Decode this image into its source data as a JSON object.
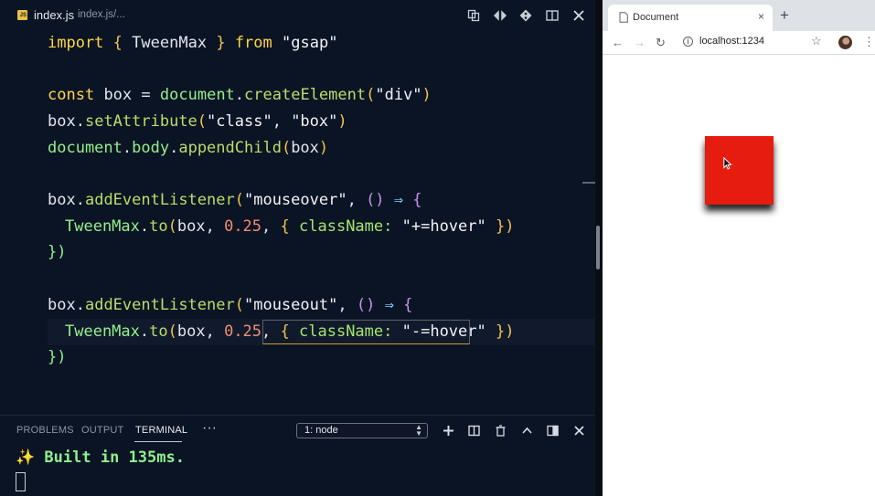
{
  "editor": {
    "tab": {
      "badge": "JS",
      "filename": "index.js",
      "path": "index.js/..."
    },
    "toolbar_icons": [
      "compare-icon",
      "go-live-icon",
      "source-control-icon",
      "split-editor-icon",
      "close-icon"
    ]
  },
  "code": {
    "import_kw": "import",
    "import_open": "{",
    "import_name": "TweenMax",
    "import_close": "}",
    "from_kw": "from",
    "import_src": "\"gsap\"",
    "const_kw": "const",
    "box_var": "box",
    "eq": "=",
    "document": "document",
    "create_element": "createElement",
    "div_str": "\"div\"",
    "set_attribute": "setAttribute",
    "class_str": "\"class\"",
    "box_str": "\"box\"",
    "body": "body",
    "append_child": "appendChild",
    "add_event_listener": "addEventListener",
    "mouseover_str": "\"mouseover\"",
    "mouseout_str": "\"mouseout\"",
    "arrow": "⇒",
    "tweenmax": "TweenMax",
    "to": "to",
    "duration": "0.25",
    "classname_key": "className:",
    "hover_in": "\"+=hover\"",
    "hover_out": "\"-=hover\"",
    "close_brace": "})"
  },
  "panel": {
    "tabs": [
      "PROBLEMS",
      "OUTPUT",
      "TERMINAL"
    ],
    "more": "···",
    "terminal_select": "1: node",
    "output_sparkle": "✨",
    "output_text": "Built in 135ms.",
    "icons": [
      "new-terminal-icon",
      "split-terminal-icon",
      "kill-terminal-icon",
      "maximize-panel-icon",
      "panel-layout-icon",
      "close-panel-icon"
    ]
  },
  "browser": {
    "tab_title": "Document",
    "tab_close": "×",
    "new_tab": "+",
    "url": "localhost:1234",
    "box_color": "#e51c0e"
  },
  "colors": {
    "editor_bg": "#0b1424",
    "keyword": "#ffd54a",
    "function": "#92f08b",
    "number": "#f08d73",
    "terminal_text": "#8ef08e"
  }
}
